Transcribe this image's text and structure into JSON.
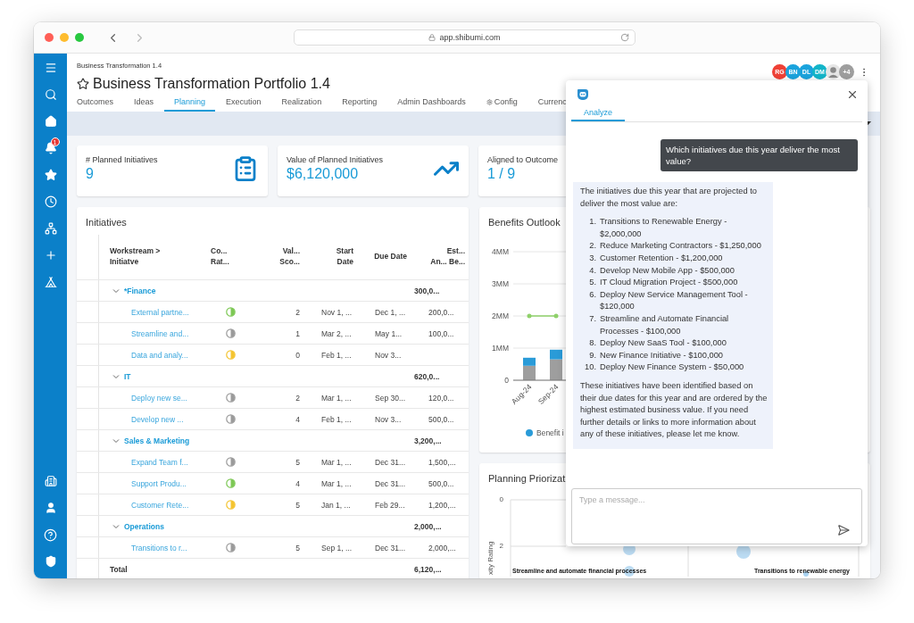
{
  "browser": {
    "url": "app.shibumi.com"
  },
  "sidebar": {
    "notification_badge": "1"
  },
  "breadcrumb": "Business Transformation 1.4",
  "title": "Business Transformation Portfolio 1.4",
  "favorite": false,
  "tabs": [
    {
      "label": "Outcomes",
      "selected": false
    },
    {
      "label": "Ideas",
      "selected": false
    },
    {
      "label": "Planning",
      "selected": true
    },
    {
      "label": "Execution",
      "selected": false
    },
    {
      "label": "Realization",
      "selected": false
    },
    {
      "label": "Reporting",
      "selected": false
    },
    {
      "label": "Admin Dashboards",
      "selected": false
    },
    {
      "label": "Config",
      "selected": false,
      "kind": "settings"
    },
    {
      "label": "Currenc",
      "selected": false
    }
  ],
  "collaborators": [
    {
      "kind": "initials",
      "initials": "RG",
      "color": "#ef4136"
    },
    {
      "kind": "initials",
      "initials": "BN",
      "color": "#1aa3dd"
    },
    {
      "kind": "initials",
      "initials": "DL",
      "color": "#1aa3dd"
    },
    {
      "kind": "initials",
      "initials": "DM",
      "color": "#13b5c9"
    },
    {
      "kind": "photo"
    },
    {
      "kind": "initials",
      "initials": "+4",
      "color": "#9e9e9e"
    }
  ],
  "kpis": [
    {
      "label": "# Planned Initiatives",
      "value": "9"
    },
    {
      "label": "Value of Planned Initiatives",
      "value": "$6,120,000"
    },
    {
      "label": "Aligned to Outcome",
      "value": "1 / 9"
    }
  ],
  "initiatives": {
    "title": "Initiatives",
    "columns": [
      "Workstream > Initiatve",
      "Co... Rat...",
      "Val... Sco...",
      "Start Date",
      "Due Date",
      "Est... An... Be..."
    ],
    "rows": [
      {
        "kind": "group",
        "expanded": true,
        "name": "*Finance",
        "est": "300,0..."
      },
      {
        "kind": "item",
        "name": "External partne...",
        "color": "#7dc855",
        "score": "2",
        "start": "Nov 1, ...",
        "due": "Dec 1, ...",
        "est": "200,0..."
      },
      {
        "kind": "item",
        "name": "Streamline and...",
        "color": "#9b9b9b",
        "score": "1",
        "start": "Mar 2, ...",
        "due": "May 1...",
        "est": "100,0..."
      },
      {
        "kind": "item",
        "name": "Data and analy...",
        "color": "#f4c430",
        "score": "0",
        "start": "Feb 1, ...",
        "due": "Nov 3..."
      },
      {
        "kind": "group",
        "expanded": true,
        "name": "IT",
        "est": "620,0..."
      },
      {
        "kind": "item",
        "name": "Deploy new se...",
        "color": "#9b9b9b",
        "score": "2",
        "start": "Mar 1, ...",
        "due": "Sep 30...",
        "est": "120,0..."
      },
      {
        "kind": "item",
        "name": "Develop new ...",
        "color": "#9b9b9b",
        "score": "4",
        "start": "Feb 1, ...",
        "due": "Nov 3...",
        "est": "500,0..."
      },
      {
        "kind": "group",
        "expanded": true,
        "name": "Sales & Marketing",
        "est": "3,200,..."
      },
      {
        "kind": "item",
        "name": "Expand Team f...",
        "color": "#9b9b9b",
        "score": "5",
        "start": "Mar 1, ...",
        "due": "Dec 31...",
        "est": "1,500,..."
      },
      {
        "kind": "item",
        "name": "Support Produ...",
        "color": "#7dc855",
        "score": "4",
        "start": "Mar 1, ...",
        "due": "Dec 31...",
        "est": "500,0..."
      },
      {
        "kind": "item",
        "name": "Customer Rete...",
        "color": "#f4c430",
        "score": "5",
        "start": "Jan 1, ...",
        "due": "Feb 29...",
        "est": "1,200,..."
      },
      {
        "kind": "group",
        "expanded": true,
        "name": "Operations",
        "est": "2,000,..."
      },
      {
        "kind": "item",
        "name": "Transitions to r...",
        "color": "#9b9b9b",
        "score": "5",
        "start": "Sep 1, ...",
        "due": "Dec 31...",
        "est": "2,000,..."
      },
      {
        "kind": "total",
        "name": "Total",
        "est": "6,120,..."
      }
    ]
  },
  "benefits": {
    "title": "Benefits Outlook",
    "chart_data": {
      "type": "bar",
      "stacked": true,
      "grid": true,
      "categories": [
        "Aug-24",
        "Sep-24"
      ],
      "ylim": [
        0,
        4
      ],
      "yticks": [
        {
          "value": 0,
          "label": "0"
        },
        {
          "value": 1,
          "label": "1MM"
        },
        {
          "value": 2,
          "label": "2MM"
        },
        {
          "value": 3,
          "label": "3MM"
        },
        {
          "value": 4,
          "label": "4MM"
        }
      ],
      "series": [
        {
          "color": "#9e9e9e",
          "values": [
            0.45,
            0.65
          ]
        },
        {
          "name": "Benefit i",
          "color": "#2a9bd8",
          "values": [
            0.25,
            0.3
          ]
        },
        {
          "type": "line",
          "color": "#8fd16a",
          "values": [
            2,
            2
          ]
        }
      ]
    }
  },
  "prioritization": {
    "title": "Planning Priorizat",
    "ylabel": "xity Rating",
    "yticks": [
      "0",
      "2"
    ],
    "labels": [
      "Streamline and automate financial processes",
      "Transitions to renewable energy"
    ]
  },
  "chat": {
    "tabs": [
      {
        "label": "Analyze",
        "selected": true
      }
    ],
    "messages": [
      {
        "kind": "user",
        "text": "Which initiatives due this year deliver the most value?"
      },
      {
        "kind": "bot",
        "intro": "The initiatives due this year that are projected to deliver the most value are:",
        "items": [
          {
            "marker": "1.",
            "text": "Transitions to Renewable Energy - $2,000,000"
          },
          {
            "marker": "2.",
            "text": "Reduce Marketing Contractors - $1,250,000"
          },
          {
            "marker": "3.",
            "text": "Customer Retention - $1,200,000"
          },
          {
            "marker": "4.",
            "text": "Develop New Mobile App - $500,000"
          },
          {
            "marker": "5.",
            "text": "IT Cloud Migration Project - $500,000"
          },
          {
            "marker": "6.",
            "text": "Deploy New Service Management Tool - $120,000"
          },
          {
            "marker": "7.",
            "text": "Streamline and Automate Financial Processes - $100,000"
          },
          {
            "marker": "8.",
            "text": "Deploy New SaaS Tool - $100,000"
          },
          {
            "marker": "9.",
            "text": "New Finance Initiative - $100,000"
          },
          {
            "marker": "10.",
            "text": "Deploy New Finance System - $50,000"
          }
        ],
        "outro": "These initiatives have been identified based on their due dates for this year and are ordered by the highest estimated business value. If you need further details or links to more information about any of these initiatives, please let me know."
      }
    ],
    "placeholder": "Type a message..."
  }
}
